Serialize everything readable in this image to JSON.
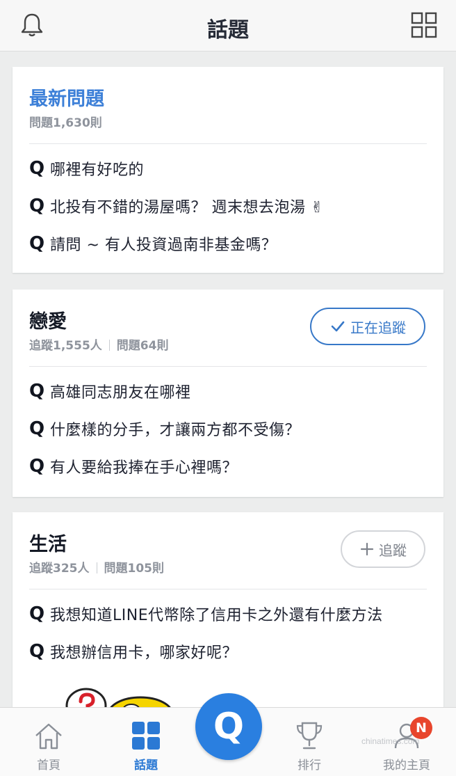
{
  "header": {
    "title": "話題"
  },
  "cards": [
    {
      "title": "最新問題",
      "meta_questions": "問題1,630則",
      "questions": [
        "哪裡有好吃的",
        "北投有不錯的湯屋嗎？ 週末想去泡湯 ✌",
        "請問 ~ 有人投資過南非基金嗎？"
      ]
    },
    {
      "title": "戀愛",
      "meta_followers": "追蹤1,555人",
      "meta_questions": "問題64則",
      "follow_label": "正在追蹤",
      "questions": [
        "高雄同志朋友在哪裡",
        "什麼樣的分手，才讓兩方都不受傷？",
        "有人要給我捧在手心裡嗎？"
      ]
    },
    {
      "title": "生活",
      "meta_followers": "追蹤325人",
      "meta_questions": "問題105則",
      "follow_label": "追蹤",
      "questions": [
        "我想知道LINE代幣除了信用卡之外還有什麼方法",
        "我想辦信用卡，哪家好呢？"
      ]
    }
  ],
  "q_mark": "Q",
  "tabbar": {
    "home": "首頁",
    "topics": "話題",
    "fab": "Q",
    "rank": "排行",
    "mine": "我的主頁",
    "badge": "N"
  },
  "watermark": "chinatimes.com",
  "colors": {
    "accent": "#2a7fe0",
    "title_blue": "#3d80d8",
    "badge": "#e8452c"
  }
}
